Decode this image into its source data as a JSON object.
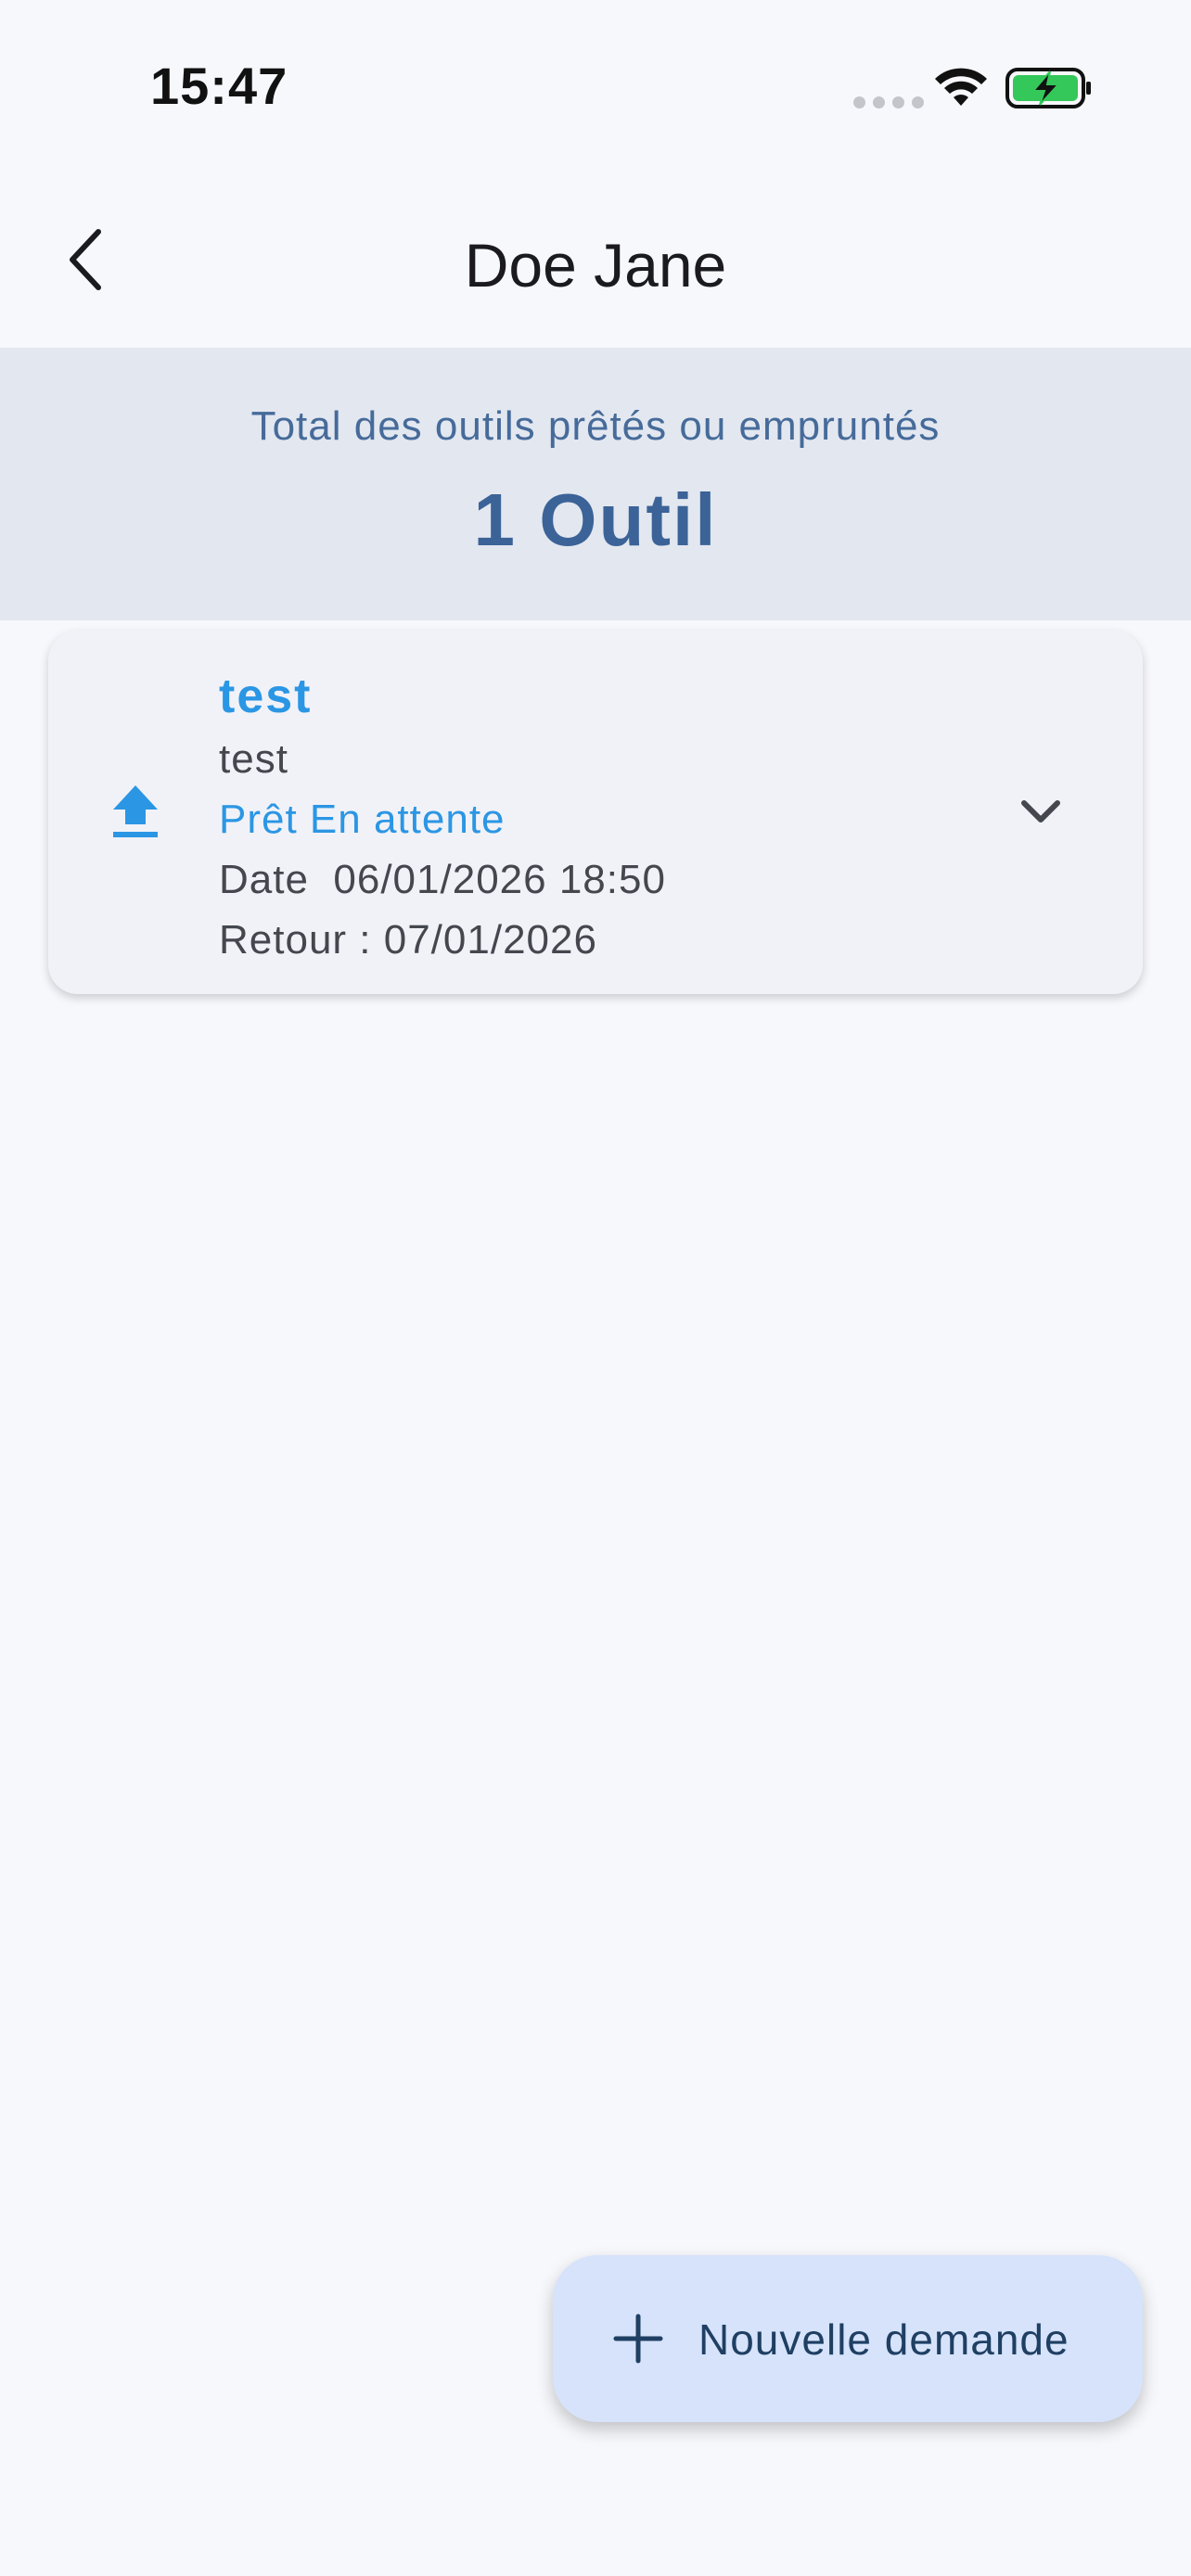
{
  "status_bar": {
    "time": "15:47",
    "icons": [
      "signal-dots-icon",
      "wifi-icon",
      "battery-charging-icon"
    ],
    "battery_color": "#34c759"
  },
  "app_bar": {
    "title": "Doe Jane",
    "back_icon": "chevron-left-icon"
  },
  "summary": {
    "label": "Total des outils prêtés ou empruntés",
    "count": "1 Outil"
  },
  "loans": [
    {
      "icon": "upload-icon",
      "title": "test",
      "subtitle": "test",
      "status": "Prêt En attente",
      "date": "Date  06/01/2026 18:50",
      "return": "Retour : 07/01/2026",
      "expand_icon": "chevron-down-icon"
    }
  ],
  "fab": {
    "icon": "plus-icon",
    "label": "Nouvelle demande"
  },
  "colors": {
    "background": "#f7f8fc",
    "accent": "#2b96e4",
    "banner": "#e3e7f0",
    "banner_text": "#3b6397",
    "fab_background": "#d6e3fa"
  }
}
